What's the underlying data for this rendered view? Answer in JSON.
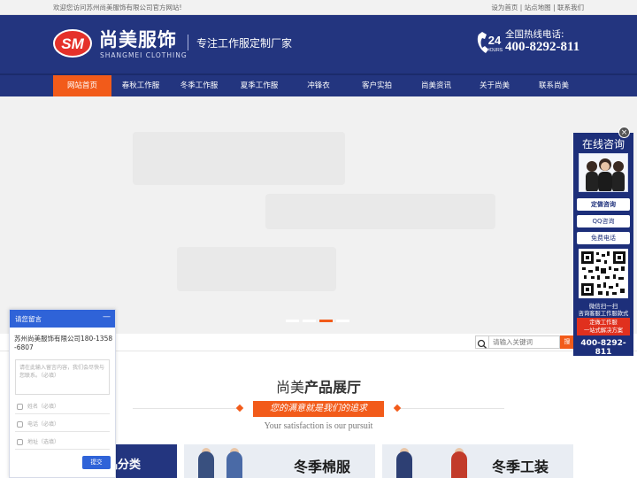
{
  "topbar": {
    "welcome": "欢迎您访问苏州尚美服饰有限公司官方网站!",
    "links": [
      "设为首页",
      "站点地图",
      "联系我们"
    ],
    "separator": " | "
  },
  "header": {
    "logo_badge": "SM",
    "logo_name": "尚美服饰",
    "logo_sub": "SHANGMEI CLOTHING",
    "slogan": "专注工作服定制厂家",
    "hotline_badge": "24",
    "hotline_badge_sub": "HOURS",
    "hotline_label": "全国热线电话:",
    "hotline_number": "400-8292-811"
  },
  "nav": {
    "items": [
      "网站首页",
      "春秋工作服",
      "冬季工作服",
      "夏季工作服",
      "冲锋衣",
      "客户实拍",
      "尚美资讯",
      "关于尚美",
      "联系尚美"
    ],
    "active_index": 0
  },
  "banner": {
    "slide_count": 4,
    "active_slide": 3
  },
  "search": {
    "placeholder": "请输入关键词",
    "button_label": "搜"
  },
  "products_section": {
    "title_prefix": "尚美",
    "title_highlight": "产品展厅",
    "ribbon": "您的满意就是我们的追求",
    "subtitle_en": "Your satisfaction is our pursuit",
    "category_label": "品分类",
    "tiles": [
      "冬季棉服",
      "冬季工装"
    ]
  },
  "float_panel": {
    "close": "×",
    "title": "在线咨询",
    "buttons": [
      "定做咨询",
      "QQ咨询",
      "免费电话"
    ],
    "scan_line1": "微信扫一扫",
    "scan_line2": "咨询客服工作服款式",
    "promo_line1": "定做工作服",
    "promo_line2": "一站式解决方案",
    "phone": "400-8292-811"
  },
  "message_widget": {
    "title": "请您留言",
    "minimize": "—",
    "company": "苏州尚美服饰有限公司180-1358-6807",
    "textarea_placeholder": "请在此输入留言内容，我们会尽快与您联系。（必填）",
    "fields": [
      "姓名（必填）",
      "电话（必填）",
      "地址（选填）"
    ],
    "submit": "提交"
  },
  "colors": {
    "brand_blue": "#23357f",
    "accent_orange": "#f25b1a",
    "widget_blue": "#2f63d8"
  }
}
